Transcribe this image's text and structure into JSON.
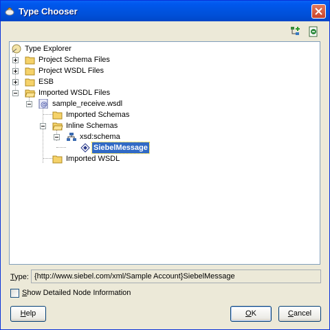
{
  "window": {
    "title": "Type Chooser"
  },
  "toolbar": {
    "buttons": [
      "hierarchy-add-icon",
      "schema-import-icon"
    ]
  },
  "tree": {
    "root": "Type Explorer",
    "nodes": [
      {
        "label": "Project Schema Files",
        "expanded": false
      },
      {
        "label": "Project WSDL Files",
        "expanded": false
      },
      {
        "label": "ESB",
        "expanded": false
      },
      {
        "label": "Imported WSDL Files",
        "expanded": true
      },
      {
        "label": "sample_receive.wsdl",
        "expanded": true
      },
      {
        "label": "Imported Schemas"
      },
      {
        "label": "Inline Schemas",
        "expanded": true
      },
      {
        "label": "xsd:schema",
        "expanded": true
      },
      {
        "label": "SiebelMessage",
        "selected": true
      },
      {
        "label": "Imported WSDL"
      }
    ]
  },
  "type": {
    "label_underline": "T",
    "label_rest": "ype:",
    "value": "{http://www.siebel.com/xml/Sample Account}SiebelMessage"
  },
  "show_detailed": {
    "label_underline": "S",
    "label_rest": "how Detailed Node Information",
    "checked": false
  },
  "buttons": {
    "help": {
      "u": "H",
      "rest": "elp"
    },
    "ok": {
      "u": "O",
      "rest": "K"
    },
    "cancel": {
      "u": "C",
      "rest": "ancel"
    }
  }
}
